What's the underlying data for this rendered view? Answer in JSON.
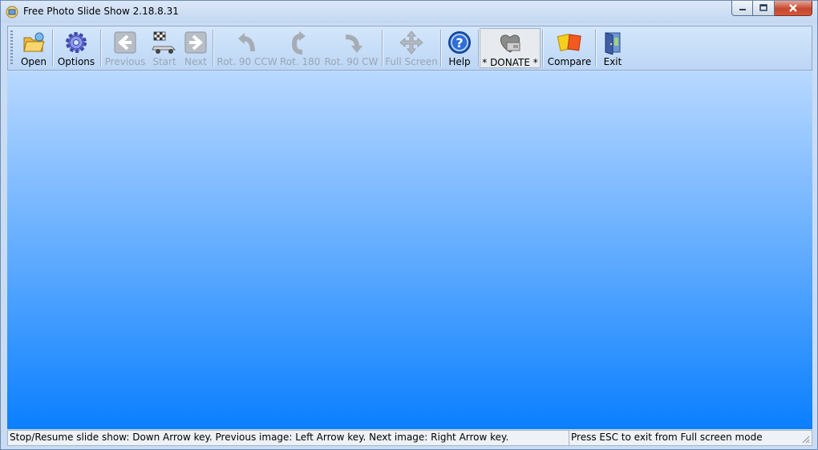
{
  "window": {
    "title": "Free Photo Slide Show 2.18.8.31"
  },
  "toolbar": {
    "buttons": [
      {
        "label": "Open",
        "icon": "folder-open-icon",
        "enabled": true
      },
      {
        "label": "Options",
        "icon": "gear-icon",
        "enabled": true
      },
      {
        "label": "Previous",
        "icon": "arrow-left-icon",
        "enabled": false
      },
      {
        "label": "Start",
        "icon": "race-car-flag-icon",
        "enabled": false
      },
      {
        "label": "Next",
        "icon": "arrow-right-icon",
        "enabled": false
      },
      {
        "label": "Rot. 90 CCW",
        "icon": "rotate-ccw-icon",
        "enabled": false
      },
      {
        "label": "Rot. 180",
        "icon": "rotate-180-icon",
        "enabled": false
      },
      {
        "label": "Rot. 90 CW",
        "icon": "rotate-cw-icon",
        "enabled": false
      },
      {
        "label": "Full Screen",
        "icon": "fullscreen-arrows-icon",
        "enabled": false
      },
      {
        "label": "Help",
        "icon": "help-icon",
        "enabled": true
      },
      {
        "label": "* DONATE *",
        "icon": "heart-wallet-icon",
        "enabled": true
      },
      {
        "label": "Compare",
        "icon": "cards-icon",
        "enabled": true
      },
      {
        "label": "Exit",
        "icon": "exit-door-icon",
        "enabled": true
      }
    ]
  },
  "colors": {
    "client_top": "#b8d8ff",
    "client_bottom": "#0a7fff",
    "disabled_text": "#9aa6b4"
  },
  "statusbar": {
    "left": "Stop/Resume slide show: Down Arrow key. Previous image: Left Arrow key. Next image: Right Arrow key.",
    "right": "Press ESC to exit from Full screen mode"
  }
}
